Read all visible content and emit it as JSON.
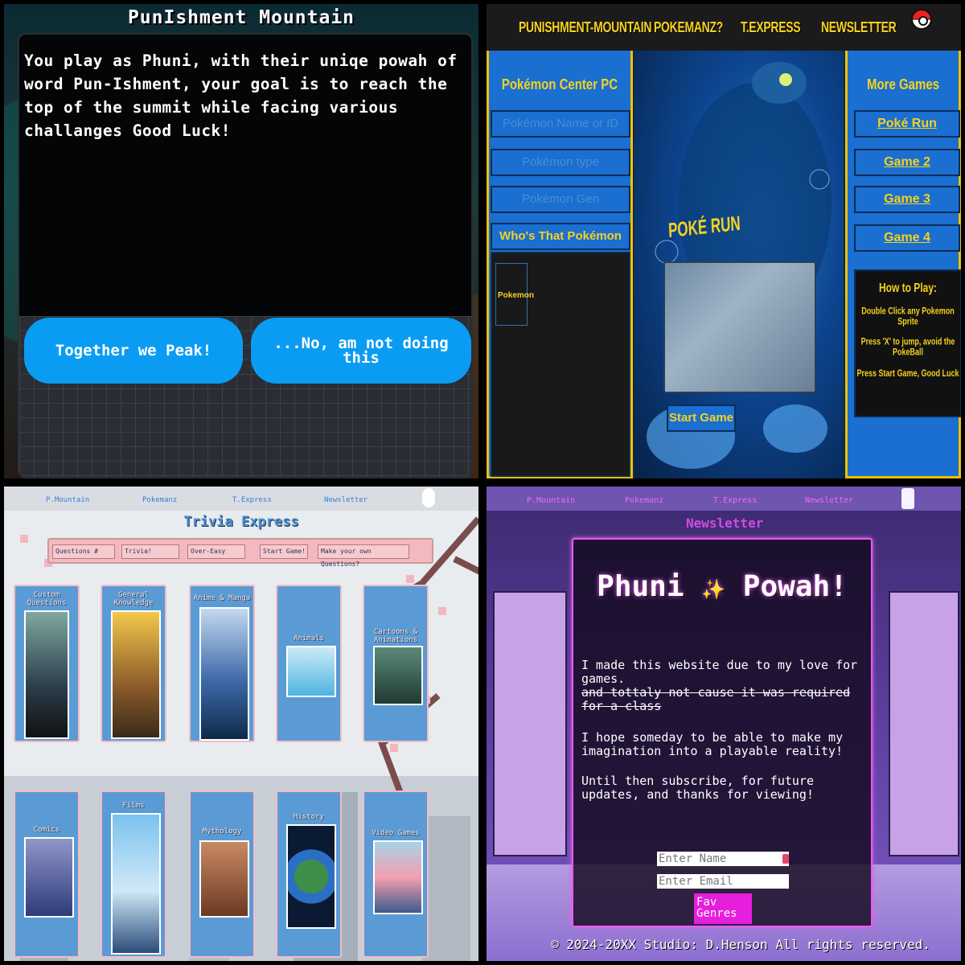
{
  "punishment": {
    "title": "PunIshment Mountain",
    "intro": "You play as Phuni, with their uniqe powah of word Pun-Ishment, your goal is to reach the top of the summit while facing various challanges Good Luck!",
    "choice_yes": "Together we Peak!",
    "choice_no": "...No, am not doing this"
  },
  "pokemanz": {
    "nav": [
      "PUNISHMENT-MOUNTAIN",
      "POKEMANZ?",
      "T.EXPRESS",
      "NEWSLETTER"
    ],
    "left_heading": "Pokémon Center PC",
    "name_placeholder": "Pokémon Name or ID",
    "type_placeholder": "Pokémon type",
    "gen_placeholder": "Pokémon Gen",
    "whos_that": "Who's That Pokémon",
    "card_label": "Pokemon",
    "game_title": "POKÉ RUN",
    "start_game": "Start Game",
    "right_heading": "More Games",
    "games": [
      "Poké Run",
      "Game 2",
      "Game 3",
      "Game 4"
    ],
    "how_to": {
      "title": "How to Play:",
      "steps": [
        "Double Click any Pokemon Sprite",
        "Press 'X' to jump, avoid the PokeBall",
        "Press Start Game, Good Luck"
      ]
    }
  },
  "trivia": {
    "nav": [
      "P.Mountain",
      "Pokemanz",
      "T.Express",
      "Newsletter"
    ],
    "title": "Trivia Express",
    "questions_label": "Questions #",
    "type_value": "Trivia!",
    "difficulty_value": "Over-Easy",
    "start_label": "Start Game!",
    "custom_placeholder": "Make your own Questions?",
    "categories_row1": [
      "Custom Questions",
      "General Knowledge",
      "Anime & Manga",
      "Animals",
      "Cartoons & Animations"
    ],
    "categories_row2": [
      "Comics",
      "Films",
      "Mythology",
      "History",
      "Video Games"
    ]
  },
  "newsletter": {
    "nav": [
      "P.Mountain",
      "Pokemanz",
      "T.Express",
      "Newsletter"
    ],
    "subtitle": "Newsletter",
    "heading_left": "Phuni",
    "heading_right": "Powah!",
    "p1": "I made this website due to my love for games.",
    "p1_strike": "and tottaly not cause it was required for a class",
    "p2": "I hope someday to be able to make my imagination into a playable reality!",
    "p3": "Until then subscribe, for future updates, and thanks for viewing!",
    "name_placeholder": "Enter Name",
    "email_placeholder": "Enter Email",
    "fav_genres": "Fav Genres",
    "footer": "© 2024-20XX Studio: D.Henson All rights reserved."
  },
  "colors": {
    "dialog_button": "#0a9cf2",
    "poke_yellow": "#f5d21e",
    "poke_blue": "#1a6fd0",
    "neon_pink": "#e85cf0"
  }
}
